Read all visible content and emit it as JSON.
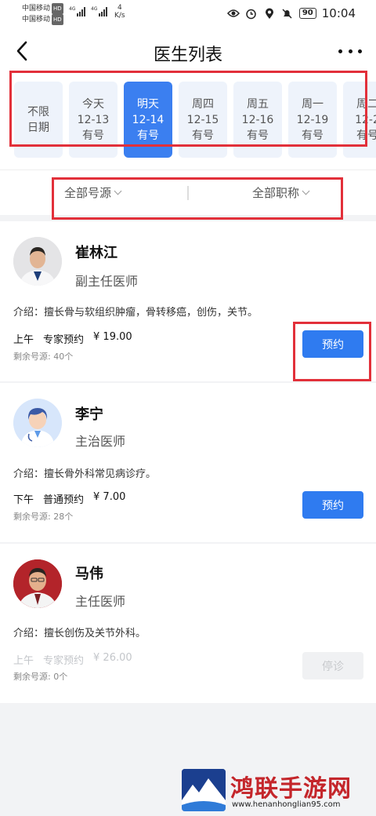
{
  "status_bar": {
    "carrier_1": "中国移动",
    "carrier_2": "中国移动",
    "hd": "HD",
    "net": "4G",
    "speed_value": "4",
    "speed_unit": "K/s",
    "battery": "90",
    "time": "10:04"
  },
  "header": {
    "title": "医生列表",
    "back_icon": "chevron-left-icon",
    "more_icon": "more-dots-icon"
  },
  "dates": [
    {
      "line1": "不限",
      "line2": "日期",
      "line3": "",
      "active": false
    },
    {
      "line1": "今天",
      "line2": "12-13",
      "line3": "有号",
      "active": false
    },
    {
      "line1": "明天",
      "line2": "12-14",
      "line3": "有号",
      "active": true
    },
    {
      "line1": "周四",
      "line2": "12-15",
      "line3": "有号",
      "active": false
    },
    {
      "line1": "周五",
      "line2": "12-16",
      "line3": "有号",
      "active": false
    },
    {
      "line1": "周一",
      "line2": "12-19",
      "line3": "有号",
      "active": false
    },
    {
      "line1": "周二",
      "line2": "12-2",
      "line3": "有号",
      "active": false
    }
  ],
  "filters": {
    "source": "全部号源",
    "title": "全部职称"
  },
  "doctors": [
    {
      "name": "崔林江",
      "title": "副主任医师",
      "intro": "介绍：擅长骨与软组织肿瘤，骨转移癌，创伤，关节。",
      "period": "上午",
      "type": "专家预约",
      "price": "¥ 19.00",
      "remain": "剩余号源: 40个",
      "button": "预约"
    },
    {
      "name": "李宁",
      "title": "主治医师",
      "intro": "介绍：擅长骨外科常见病诊疗。",
      "period": "下午",
      "type": "普通预约",
      "price": "¥ 7.00",
      "remain": "剩余号源: 28个",
      "button": "预约"
    },
    {
      "name": "马伟",
      "title": "主任医师",
      "intro": "介绍：擅长创伤及关节外科。",
      "period": "上午",
      "type": "专家预约",
      "price": "¥ 26.00",
      "remain": "剩余号源: 0个",
      "button": "停诊"
    }
  ],
  "watermark": {
    "text": "鸿联手游网",
    "url": "www.henanhonglian95.com"
  },
  "colors": {
    "accent": "#2f7bf0",
    "highlight": "#e2303a"
  }
}
